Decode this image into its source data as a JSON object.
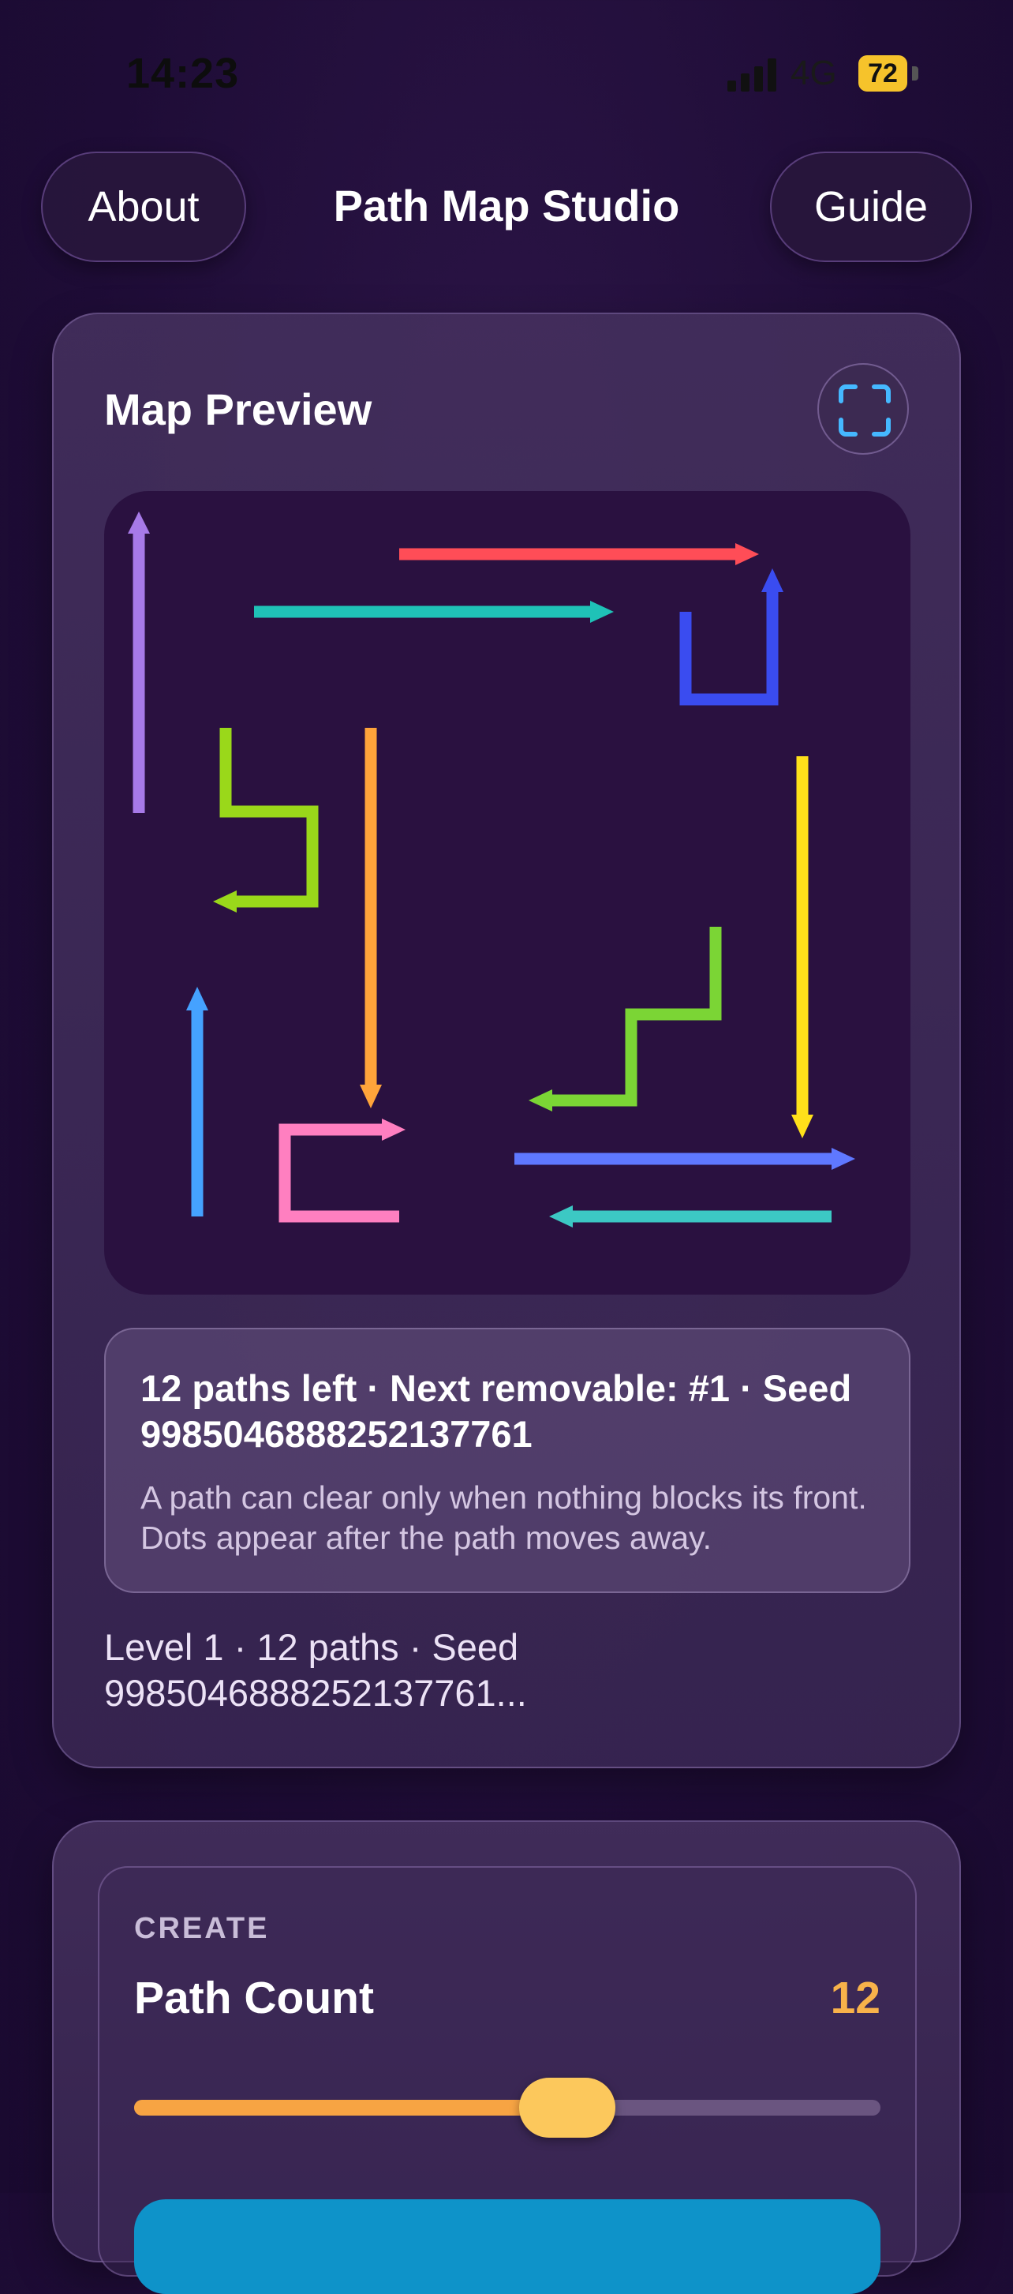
{
  "status_bar": {
    "time": "14:23",
    "network": "4G",
    "battery": "72"
  },
  "header": {
    "about_label": "About",
    "title": "Path Map Studio",
    "guide_label": "Guide"
  },
  "preview": {
    "title": "Map Preview",
    "fullscreen_icon": "fullscreen-icon",
    "map_colors": {
      "background": "#2a1140",
      "paths": [
        "#a77ae8",
        "#ff4d57",
        "#1fc2b7",
        "#3a4cf0",
        "#9ad81a",
        "#ffa43a",
        "#ffe01a",
        "#45a2ff",
        "#ff7fc0",
        "#7bd535",
        "#5f78ff",
        "#3cc8c4"
      ]
    },
    "status": "12 paths left · Next removable: #1 · Seed 9985046888252137761",
    "hint": "A path can clear only when nothing blocks its front. Dots appear after the path moves away.",
    "level_line": "Level 1 · 12 paths · Seed 9985046888252137761..."
  },
  "create": {
    "section_label": "CREATE",
    "path_count_label": "Path Count",
    "path_count_value": "12",
    "slider_fraction": 0.58,
    "colors": {
      "accent": "#f7a443",
      "thumb": "#fcc85c",
      "track": "#6a5580",
      "button": "#0e93c9"
    }
  }
}
